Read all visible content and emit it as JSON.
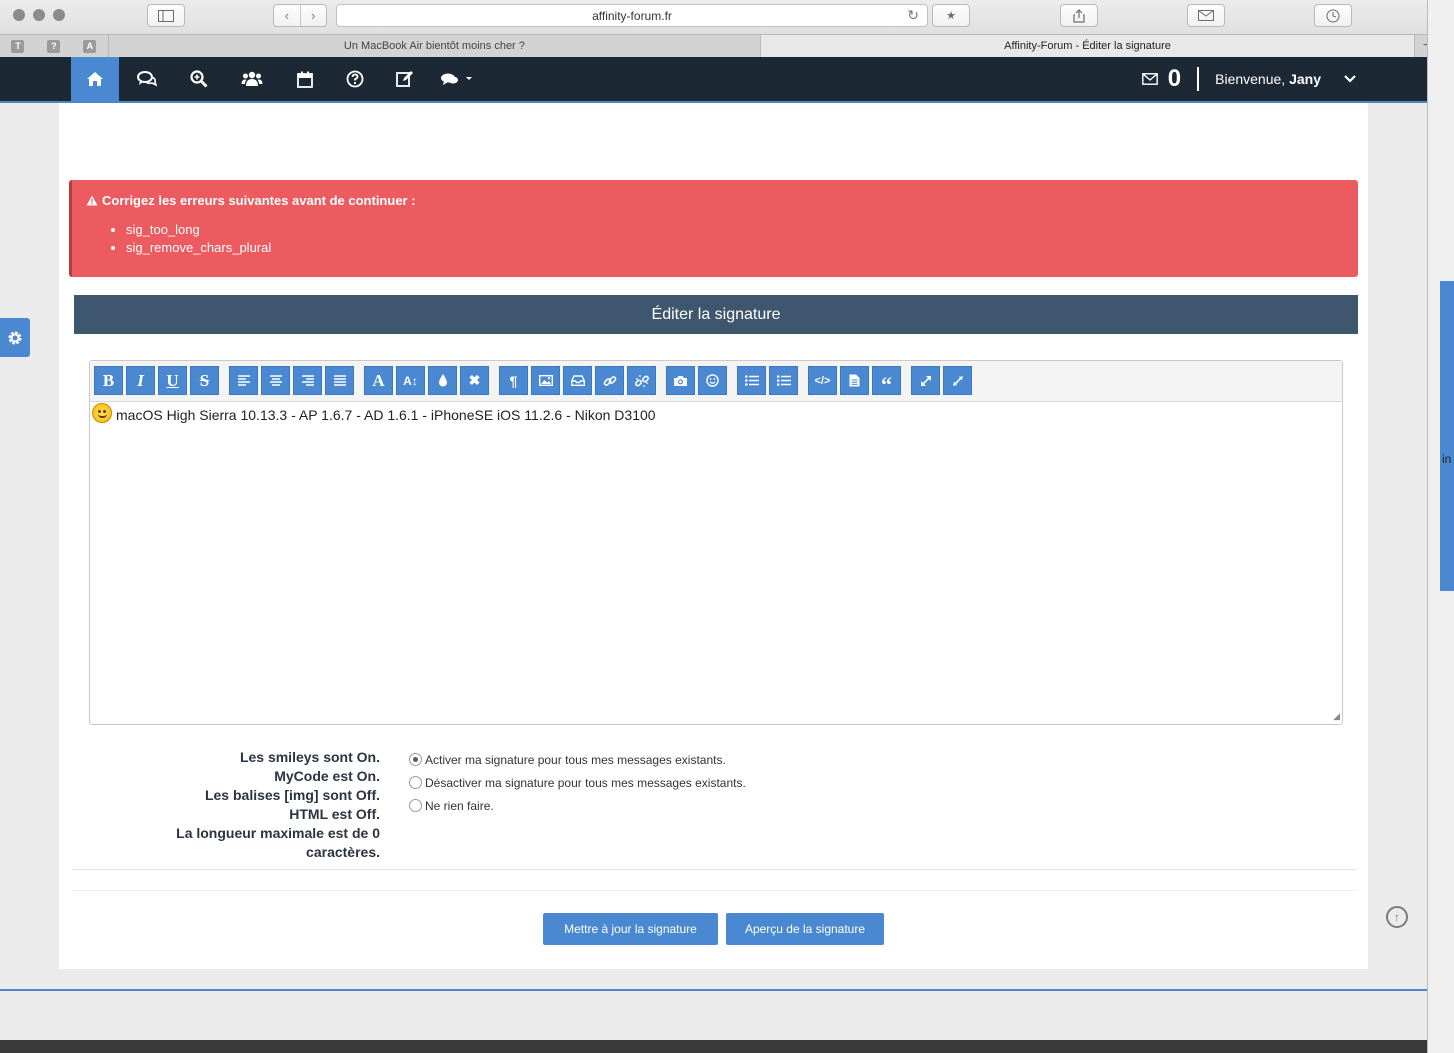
{
  "browser": {
    "url": "affinity-forum.fr",
    "tabs": [
      {
        "title": "Un MacBook Air bientôt moins cher ?"
      },
      {
        "title": "Affinity-Forum - Éditer la signature"
      }
    ],
    "pinned": [
      "T",
      "?",
      "A"
    ]
  },
  "nav": {
    "message_count": "0",
    "welcome_prefix": "Bienvenue, ",
    "username": "Jany"
  },
  "errors": {
    "title": "Corrigez les erreurs suivantes avant de continuer :",
    "items": [
      "sig_too_long",
      "sig_remove_chars_plural"
    ]
  },
  "section": {
    "title": "Éditer la signature"
  },
  "editor": {
    "content": "macOS High Sierra 10.13.3 - AP 1.6.7 - AD 1.6.1 - iPhoneSE iOS 11.2.6  - Nikon D3100"
  },
  "rules": {
    "smileys": "Les smileys sont On.",
    "mycode": "MyCode est On.",
    "img": "Les balises [img] sont Off.",
    "html": "HTML est Off.",
    "maxlen": "La longueur maximale est de 0",
    "maxlen2": "caractères."
  },
  "options": {
    "enable": "Activer ma signature pour tous mes messages existants.",
    "disable": "Désactiver ma signature pour tous mes messages existants.",
    "nothing": "Ne rien faire.",
    "selected": "enable"
  },
  "buttons": {
    "update": "Mettre à jour la signature",
    "preview": "Aperçu de la signature"
  },
  "side": {
    "fragment": "in"
  },
  "colors": {
    "accent": "#4a89d2",
    "error": "#ec5b60",
    "header": "#3f566f",
    "navbar": "#1c2833"
  }
}
